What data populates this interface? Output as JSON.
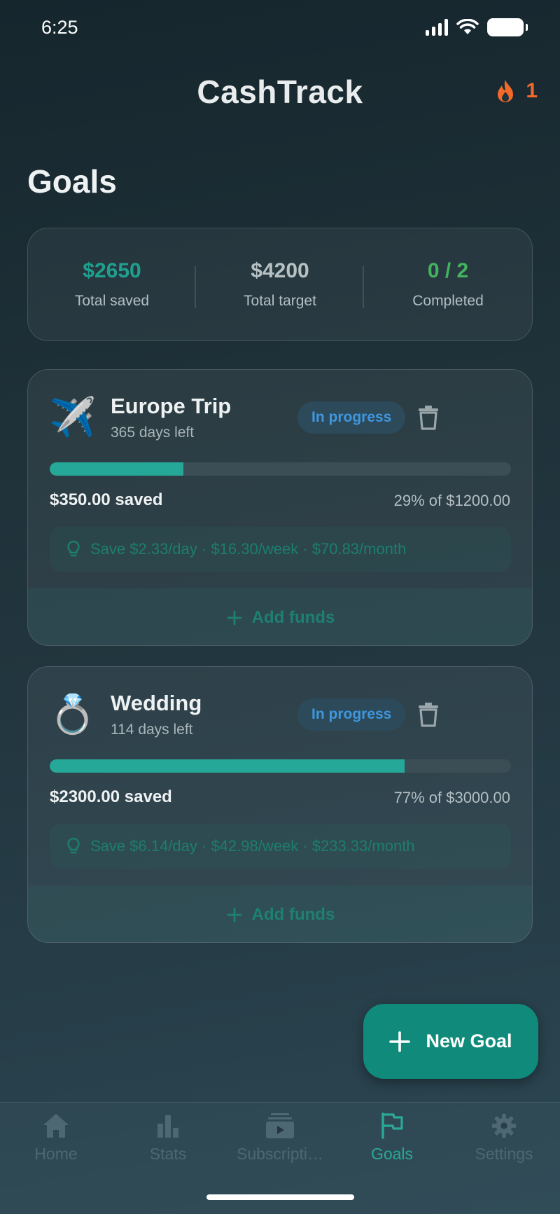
{
  "status_bar": {
    "time": "6:25"
  },
  "header": {
    "app_title": "CashTrack",
    "streak_count": "1"
  },
  "page": {
    "title": "Goals"
  },
  "summary": {
    "total_saved": {
      "value": "$2650",
      "label": "Total saved",
      "color": "#1fa08f"
    },
    "total_target": {
      "value": "$4200",
      "label": "Total target",
      "color": "#b7c1c4"
    },
    "completed": {
      "value": "0 / 2",
      "label": "Completed",
      "color": "#43b35e"
    }
  },
  "goals": [
    {
      "icon": "airplane-icon",
      "emoji": "✈️",
      "name": "Europe Trip",
      "days_left": "365 days left",
      "status": "In progress",
      "progress": 0.29,
      "saved": "$350.00 saved",
      "percent_of": "29% of $1200.00",
      "tip": "Save $2.33/day · $16.30/week · $70.83/month",
      "add_funds": "Add funds"
    },
    {
      "icon": "ring-icon",
      "emoji": "💍",
      "name": "Wedding",
      "days_left": "114 days left",
      "status": "In progress",
      "progress": 0.77,
      "saved": "$2300.00 saved",
      "percent_of": "77% of $3000.00",
      "tip": "Save $6.14/day · $42.98/week · $233.33/month",
      "add_funds": "Add funds"
    }
  ],
  "fab": {
    "label": "New Goal"
  },
  "nav": {
    "home": "Home",
    "stats": "Stats",
    "subscriptions": "Subscripti…",
    "goals": "Goals",
    "settings": "Settings"
  },
  "colors": {
    "accent": "#26a898",
    "streak": "#f26a2a",
    "pill_text": "#3f97e0"
  }
}
